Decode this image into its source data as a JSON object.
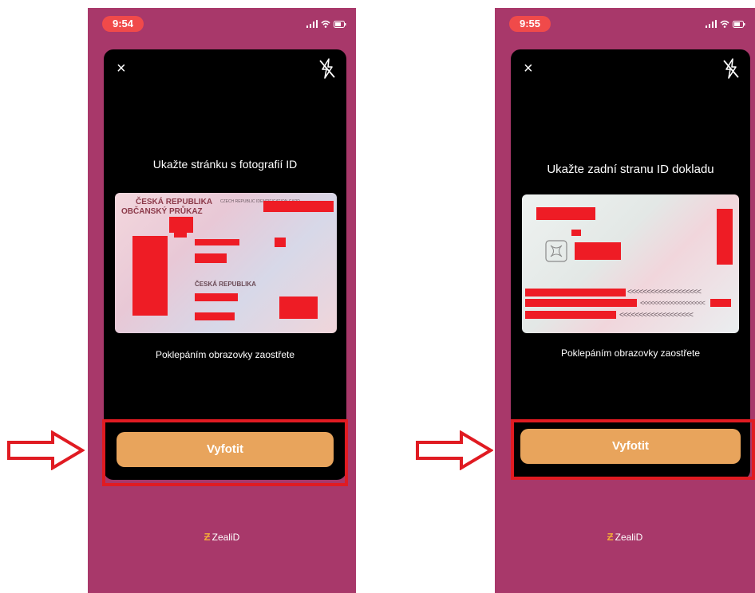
{
  "screens": [
    {
      "time": "9:54",
      "close_glyph": "×",
      "instruction": "Ukažte stránku s fotografií ID",
      "card": {
        "title1": "ČESKÁ REPUBLIKA",
        "title2": "OBČANSKÝ PRŮKAZ",
        "title_en": "CZECH REPUBLIC IDENTIFICATION CARD",
        "nationality": "ČESKÁ REPUBLIKA"
      },
      "tap_hint": "Poklepáním obrazovky zaostřete",
      "button": "Vyfotit",
      "logo": "ZealiD"
    },
    {
      "time": "9:55",
      "close_glyph": "×",
      "instruction": "Ukažte zadní stranu ID dokladu",
      "card": {
        "mrz_fill": "<<<<<<<<<<<<<<<<<<<"
      },
      "tap_hint": "Poklepáním obrazovky zaostřete",
      "button": "Vyfotit",
      "logo": "ZealiD"
    }
  ],
  "colors": {
    "app_bg": "#a8386a",
    "button": "#e8a45c",
    "highlight": "#e01b22",
    "time_pill": "#f04a4a"
  },
  "icons": [
    "close-icon",
    "flash-off-icon",
    "signal-icon",
    "wifi-icon",
    "battery-icon",
    "arrow-right-icon",
    "zealid-logo-icon"
  ]
}
